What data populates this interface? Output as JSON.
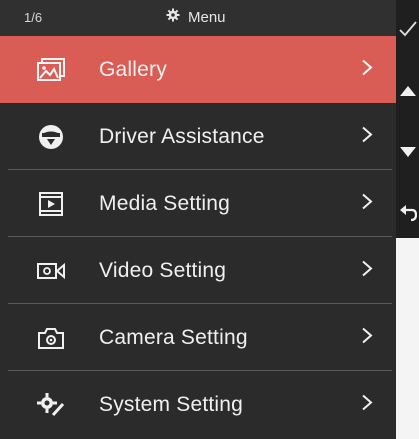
{
  "header": {
    "page_indicator": "1/6",
    "title": "Menu",
    "title_icon": "gear-icon"
  },
  "menu": {
    "items": [
      {
        "label": "Gallery",
        "icon": "gallery-icon",
        "active": true
      },
      {
        "label": "Driver Assistance",
        "icon": "steering-wheel-icon",
        "active": false
      },
      {
        "label": "Media Setting",
        "icon": "media-player-icon",
        "active": false
      },
      {
        "label": "Video Setting",
        "icon": "video-camera-icon",
        "active": false
      },
      {
        "label": "Camera Setting",
        "icon": "camera-icon",
        "active": false
      },
      {
        "label": "System Setting",
        "icon": "system-settings-icon",
        "active": false
      }
    ]
  },
  "side_controls": {
    "confirm_icon": "checkmark-icon",
    "up_icon": "arrow-up-icon",
    "down_icon": "arrow-down-icon",
    "back_icon": "back-arrow-icon"
  },
  "colors": {
    "active_item": "#d95d55",
    "background": "#2b2b2b",
    "text": "#f0f0f0"
  }
}
